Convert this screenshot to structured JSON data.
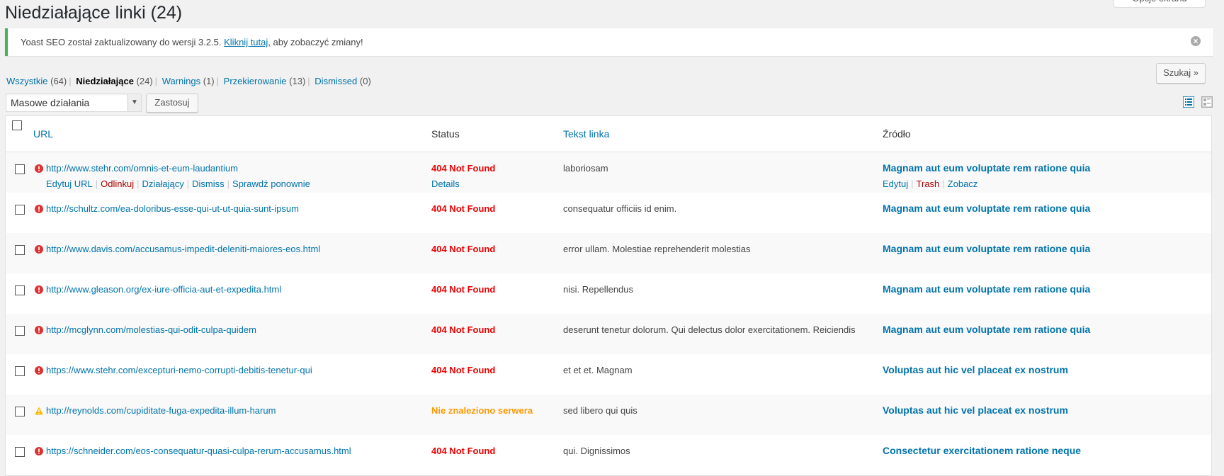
{
  "page": {
    "title": "Niedziałające linki (24)",
    "screen_options": "Opcje ekranu"
  },
  "notice": {
    "prefix": "Yoast SEO został zaktualizowany do wersji 3.2.5. ",
    "link": "Kliknij tutaj",
    "suffix": ", aby zobaczyć zmiany!"
  },
  "filters": [
    {
      "label": "Wszystkie",
      "count": "(64)",
      "current": false
    },
    {
      "label": "Niedziałające",
      "count": "(24)",
      "current": true
    },
    {
      "label": "Warnings",
      "count": "(1)",
      "current": false
    },
    {
      "label": "Przekierowanie",
      "count": "(13)",
      "current": false
    },
    {
      "label": "Dismissed",
      "count": "(0)",
      "current": false
    }
  ],
  "search_button": "Szukaj »",
  "bulk": {
    "selected": "Masowe działania",
    "apply": "Zastosuj"
  },
  "table": {
    "headers": {
      "url": "URL",
      "status": "Status",
      "text": "Tekst linka",
      "source": "Źródło"
    },
    "row_actions": {
      "url": [
        "Edytuj URL",
        "Odlinkuj",
        "Działający",
        "Dismiss",
        "Sprawdź ponownie"
      ],
      "status": "Details",
      "source": [
        "Edytuj",
        "Trash",
        "Zobacz"
      ]
    },
    "rows": [
      {
        "url": "http://www.stehr.com/omnis-et-eum-laudantium",
        "status": "404 Not Found",
        "level": "error",
        "text": "laboriosam",
        "source": "Magnam aut eum voluptate rem ratione quia"
      },
      {
        "url": "http://schultz.com/ea-doloribus-esse-qui-ut-ut-quia-sunt-ipsum",
        "status": "404 Not Found",
        "level": "error",
        "text": "consequatur officiis id enim.",
        "source": "Magnam aut eum voluptate rem ratione quia"
      },
      {
        "url": "http://www.davis.com/accusamus-impedit-deleniti-maiores-eos.html",
        "status": "404 Not Found",
        "level": "error",
        "text": "error ullam. Molestiae reprehenderit molestias",
        "source": "Magnam aut eum voluptate rem ratione quia"
      },
      {
        "url": "http://www.gleason.org/ex-iure-officia-aut-et-expedita.html",
        "status": "404 Not Found",
        "level": "error",
        "text": "nisi. Repellendus",
        "source": "Magnam aut eum voluptate rem ratione quia"
      },
      {
        "url": "http://mcglynn.com/molestias-qui-odit-culpa-quidem",
        "status": "404 Not Found",
        "level": "error",
        "text": "deserunt tenetur dolorum. Qui delectus dolor exercitationem. Reiciendis",
        "source": "Magnam aut eum voluptate rem ratione quia"
      },
      {
        "url": "https://www.stehr.com/excepturi-nemo-corrupti-debitis-tenetur-qui",
        "status": "404 Not Found",
        "level": "error",
        "text": "et et et. Magnam",
        "source": "Voluptas aut hic vel placeat ex nostrum"
      },
      {
        "url": "http://reynolds.com/cupiditate-fuga-expedita-illum-harum",
        "status": "Nie znaleziono serwera",
        "level": "warning",
        "text": "sed libero qui quis",
        "source": "Voluptas aut hic vel placeat ex nostrum"
      },
      {
        "url": "https://schneider.com/eos-consequatur-quasi-culpa-rerum-accusamus.html",
        "status": "404 Not Found",
        "level": "error",
        "text": "qui. Dignissimos",
        "source": "Consectetur exercitationem ratione neque"
      }
    ]
  },
  "colors": {
    "error": "#e00000",
    "warning": "#ff9900",
    "link": "#0073aa",
    "notice_border": "#46b450"
  }
}
